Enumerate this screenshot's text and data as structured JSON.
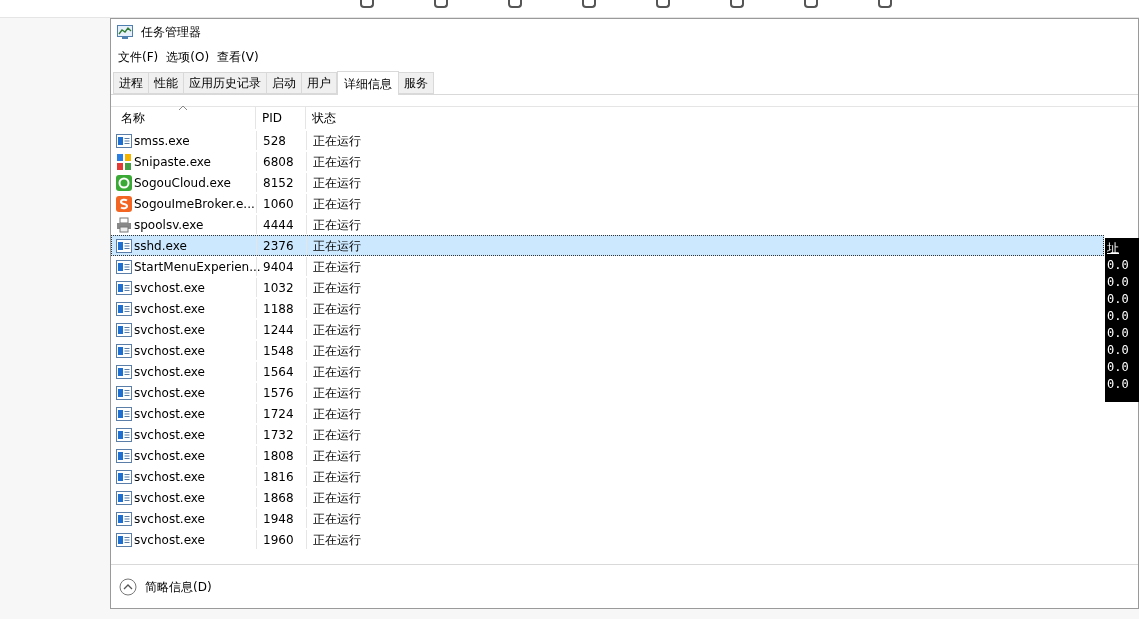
{
  "window": {
    "title": "任务管理器"
  },
  "menu": [
    "文件(F)",
    "选项(O)",
    "查看(V)"
  ],
  "tabs": [
    {
      "label": "进程",
      "selected": false
    },
    {
      "label": "性能",
      "selected": false
    },
    {
      "label": "应用历史记录",
      "selected": false
    },
    {
      "label": "启动",
      "selected": false
    },
    {
      "label": "用户",
      "selected": false
    },
    {
      "label": "详细信息",
      "selected": true
    },
    {
      "label": "服务",
      "selected": false
    }
  ],
  "table": {
    "columns": [
      "名称",
      "PID",
      "状态"
    ],
    "rows": [
      {
        "name": "smss.exe",
        "pid": "528",
        "status": "正在运行",
        "selected": false
      },
      {
        "name": "Snipaste.exe",
        "pid": "6808",
        "status": "正在运行",
        "selected": false
      },
      {
        "name": "SogouCloud.exe",
        "pid": "8152",
        "status": "正在运行",
        "selected": false
      },
      {
        "name": "SogouImeBroker.e...",
        "pid": "1060",
        "status": "正在运行",
        "selected": false
      },
      {
        "name": "spoolsv.exe",
        "pid": "4444",
        "status": "正在运行",
        "selected": false
      },
      {
        "name": "sshd.exe",
        "pid": "2376",
        "status": "正在运行",
        "selected": true
      },
      {
        "name": "StartMenuExperien...",
        "pid": "9404",
        "status": "正在运行",
        "selected": false
      },
      {
        "name": "svchost.exe",
        "pid": "1032",
        "status": "正在运行",
        "selected": false
      },
      {
        "name": "svchost.exe",
        "pid": "1188",
        "status": "正在运行",
        "selected": false
      },
      {
        "name": "svchost.exe",
        "pid": "1244",
        "status": "正在运行",
        "selected": false
      },
      {
        "name": "svchost.exe",
        "pid": "1548",
        "status": "正在运行",
        "selected": false
      },
      {
        "name": "svchost.exe",
        "pid": "1564",
        "status": "正在运行",
        "selected": false
      },
      {
        "name": "svchost.exe",
        "pid": "1576",
        "status": "正在运行",
        "selected": false
      },
      {
        "name": "svchost.exe",
        "pid": "1724",
        "status": "正在运行",
        "selected": false
      },
      {
        "name": "svchost.exe",
        "pid": "1732",
        "status": "正在运行",
        "selected": false
      },
      {
        "name": "svchost.exe",
        "pid": "1808",
        "status": "正在运行",
        "selected": false
      },
      {
        "name": "svchost.exe",
        "pid": "1816",
        "status": "正在运行",
        "selected": false
      },
      {
        "name": "svchost.exe",
        "pid": "1868",
        "status": "正在运行",
        "selected": false
      },
      {
        "name": "svchost.exe",
        "pid": "1948",
        "status": "正在运行",
        "selected": false
      },
      {
        "name": "svchost.exe",
        "pid": "1960",
        "status": "正在运行",
        "selected": false
      }
    ]
  },
  "footer": {
    "label": "简略信息(D)"
  },
  "terminal": {
    "header": "址",
    "lines": [
      "0.0",
      "0.0",
      "0.0",
      "0.0",
      "0.0",
      "0.0",
      "0.0",
      "0.0"
    ]
  }
}
